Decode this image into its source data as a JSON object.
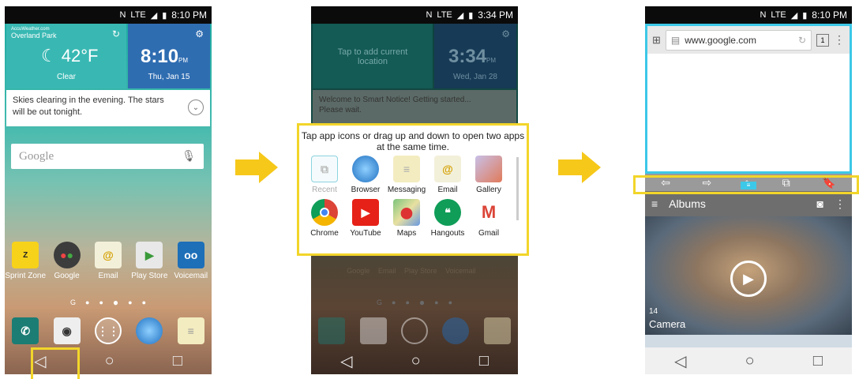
{
  "phone1": {
    "status": {
      "time": "8:10 PM",
      "network": "LTE"
    },
    "weather": {
      "source": "AccuWeather.com",
      "location": "Overland Park",
      "temp": "42°F",
      "condition": "Clear",
      "clock": "8:10",
      "ampm": "PM",
      "date": "Thu, Jan 15",
      "forecast": "Skies clearing in the evening. The stars will be out tonight."
    },
    "search_placeholder": "Google",
    "apps": [
      {
        "label": "Sprint Zone",
        "icon": "sprint-zone-icon"
      },
      {
        "label": "Google",
        "icon": "google-folder-icon"
      },
      {
        "label": "Email",
        "icon": "email-icon"
      },
      {
        "label": "Play Store",
        "icon": "play-store-icon"
      },
      {
        "label": "Voicemail",
        "icon": "voicemail-icon"
      }
    ],
    "dock": [
      "phone-icon",
      "camera-icon",
      "apps-icon",
      "browser-icon",
      "messaging-icon"
    ]
  },
  "phone2": {
    "status": {
      "time": "3:34 PM",
      "network": "LTE"
    },
    "weather": {
      "add_location": "Tap to add current location",
      "clock": "3:34",
      "ampm": "PM",
      "date": "Wed, Jan 28",
      "notice": "Welcome to Smart Notice! Getting started... Please wait."
    },
    "popup": {
      "instruction": "Tap app icons or drag up and down to open two apps at the same time.",
      "apps": [
        {
          "label": "Recent",
          "icon": "recent-icon"
        },
        {
          "label": "Browser",
          "icon": "browser-icon"
        },
        {
          "label": "Messaging",
          "icon": "messaging-icon"
        },
        {
          "label": "Email",
          "icon": "email-icon"
        },
        {
          "label": "Gallery",
          "icon": "gallery-icon"
        },
        {
          "label": "Chrome",
          "icon": "chrome-icon"
        },
        {
          "label": "YouTube",
          "icon": "youtube-icon"
        },
        {
          "label": "Maps",
          "icon": "maps-icon"
        },
        {
          "label": "Hangouts",
          "icon": "hangouts-icon"
        },
        {
          "label": "Gmail",
          "icon": "gmail-icon"
        }
      ]
    },
    "bg_labels": [
      "Google",
      "Email",
      "Play Store",
      "Voicemail"
    ]
  },
  "phone3": {
    "status": {
      "time": "8:10 PM",
      "network": "LTE"
    },
    "browser": {
      "url": "www.google.com",
      "tab_count": "1"
    },
    "gallery": {
      "title": "Albums",
      "count": "14",
      "album": "Camera"
    }
  },
  "colors": {
    "highlight": "#f2d52a",
    "split_border": "#3cc8e8",
    "arrow": "#f6c81a"
  }
}
